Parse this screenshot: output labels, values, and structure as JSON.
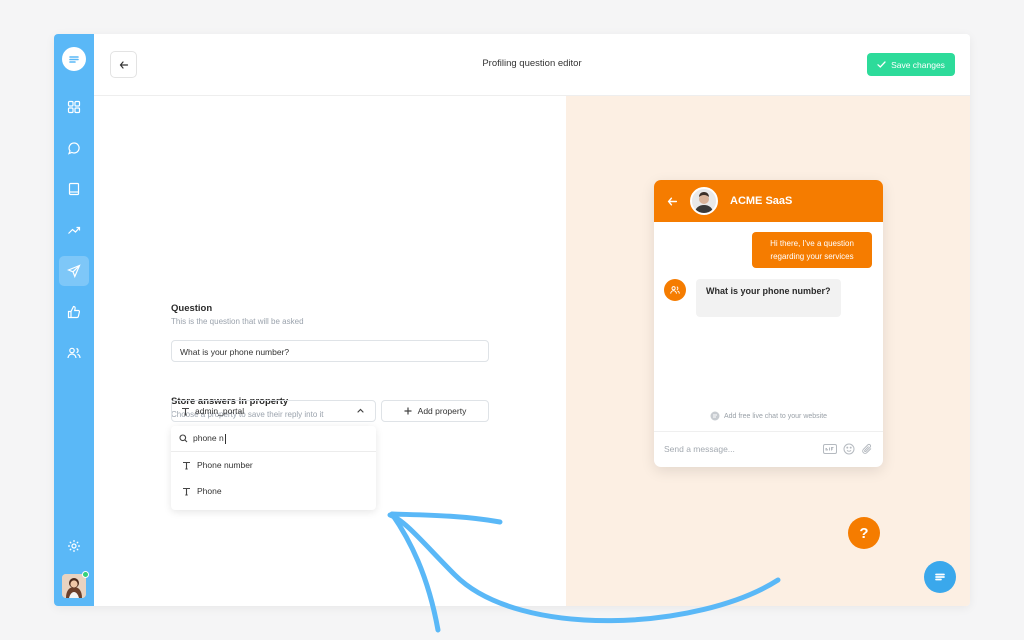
{
  "header": {
    "title": "Profiling question editor",
    "save_label": "Save changes"
  },
  "sidebar": {
    "items": [
      {
        "icon": "dashboard-icon"
      },
      {
        "icon": "chat-icon"
      },
      {
        "icon": "book-icon"
      },
      {
        "icon": "analytics-icon"
      },
      {
        "icon": "send-icon",
        "active": true
      },
      {
        "icon": "thumbs-up-icon"
      },
      {
        "icon": "users-icon"
      }
    ],
    "settings_icon": "gear-icon"
  },
  "editor": {
    "question_label": "Question",
    "question_hint": "This is the question that will be asked",
    "question_value": "What is your phone number?",
    "store_label": "Store answers in property",
    "store_hint": "Choose a property to save their reply into it",
    "selected_property": "admin_portal",
    "add_property_label": "Add property",
    "search_value": "phone n",
    "options": [
      "Phone number",
      "Phone"
    ]
  },
  "preview": {
    "company_name": "ACME SaaS",
    "user_message": "Hi there, I've a question regarding your services",
    "bot_message": "What is your phone number?",
    "powered_by": "Add free live chat to your website",
    "input_placeholder": "Send a message...",
    "help_label": "?"
  },
  "colors": {
    "sidebar": "#5ab8f7",
    "accent_green": "#2ddb9a",
    "chat_orange": "#f57c00",
    "preview_bg": "#fcefe3",
    "arrow": "#5ab8f7"
  }
}
